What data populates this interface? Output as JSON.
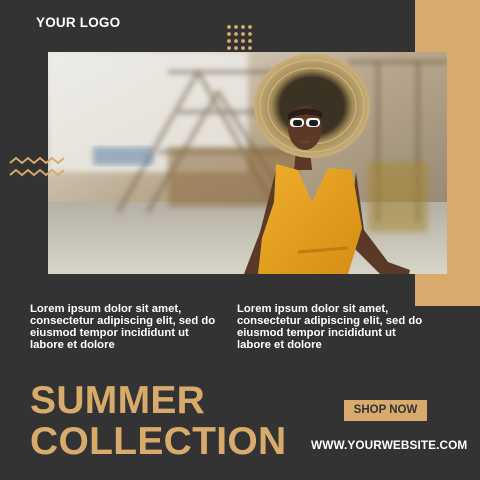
{
  "brand": {
    "logo_text": "YOUR LOGO"
  },
  "hero": {
    "photo_label": "woman-in-yellow-dress-photo"
  },
  "body": {
    "left_paragraph": "Lorem ipsum dolor sit amet, consectetur adipiscing elit, sed do eiusmod tempor incididunt ut labore et dolore",
    "right_paragraph": "Lorem ipsum dolor sit amet, consectetur adipiscing elit, sed do eiusmod tempor incididunt ut labore et dolore"
  },
  "headline": {
    "line1": "SUMMER",
    "line2": "COLLECTION"
  },
  "cta": {
    "label": "SHOP NOW"
  },
  "footer": {
    "website": "WWW.YOURWEBSITE.COM"
  },
  "colors": {
    "background": "#333333",
    "accent": "#D8AA6C",
    "text": "#FFFFFF"
  },
  "icons": {
    "dots": "dot-grid-decoration-icon",
    "zigzag": "zigzag-decoration-icon"
  }
}
